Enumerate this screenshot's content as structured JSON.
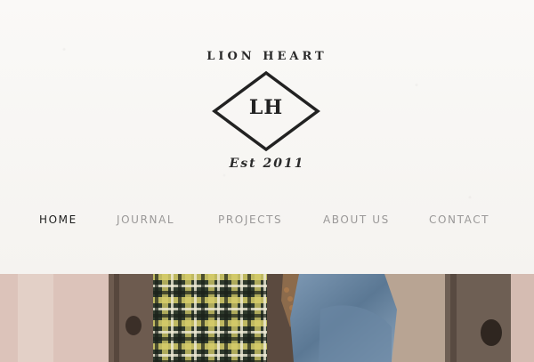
{
  "header": {
    "brand_name": "LION HEART",
    "monogram": "LH",
    "established": "Est 2011"
  },
  "nav": {
    "items": [
      {
        "label": "HOME",
        "active": true
      },
      {
        "label": "JOURNAL",
        "active": false
      },
      {
        "label": "PROJECTS",
        "active": false
      },
      {
        "label": "ABOUT US",
        "active": false
      },
      {
        "label": "CONTACT",
        "active": false
      }
    ]
  },
  "colors": {
    "background": "#f7f5f2",
    "logo_ink": "#222222",
    "nav_active": "#1e1e1e",
    "nav_inactive": "#9a9898"
  }
}
